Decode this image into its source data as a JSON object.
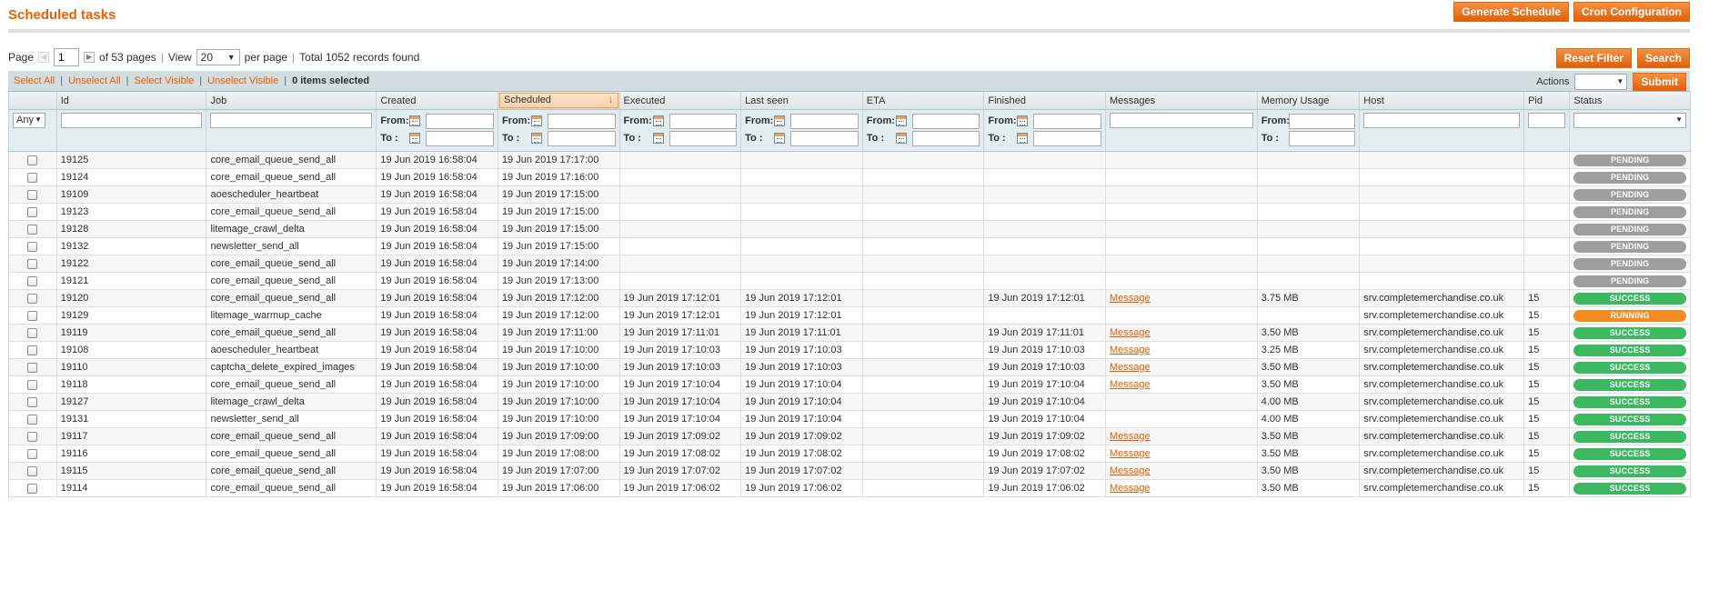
{
  "header": {
    "title": "Scheduled tasks",
    "generate_schedule_label": "Generate Schedule",
    "cron_configuration_label": "Cron Configuration"
  },
  "pager": {
    "page_label": "Page",
    "current_page": "1",
    "of_pages": "of 53 pages",
    "view_label": "View",
    "per_page_value": "20",
    "per_page_label": "per page",
    "total_records": "Total 1052 records found",
    "reset_filter_label": "Reset Filter",
    "search_label": "Search"
  },
  "massaction": {
    "select_all": "Select All",
    "unselect_all": "Unselect All",
    "select_visible": "Select Visible",
    "unselect_visible": "Unselect Visible",
    "items_selected": "0 items selected",
    "actions_label": "Actions",
    "submit_label": "Submit"
  },
  "columns": {
    "id": "Id",
    "job": "Job",
    "created": "Created",
    "scheduled": "Scheduled",
    "executed": "Executed",
    "last_seen": "Last seen",
    "eta": "ETA",
    "finished": "Finished",
    "messages": "Messages",
    "memory_usage": "Memory Usage",
    "host": "Host",
    "pid": "Pid",
    "status": "Status"
  },
  "filters": {
    "any_option": "Any",
    "from_label": "From:",
    "to_label": "To :"
  },
  "sort_icon": "sort-down-arrow-icon",
  "colors": {
    "accent": "#eb5e00",
    "pending": "#9e9e9e",
    "success": "#3cb861",
    "running": "#f58b1f"
  },
  "rows": [
    {
      "id": "19125",
      "job": "core_email_queue_send_all",
      "created": "19 Jun 2019 16:58:04",
      "scheduled": "19 Jun 2019 17:17:00",
      "executed": "",
      "last_seen": "",
      "eta": "",
      "finished": "",
      "message": "",
      "memory": "",
      "host": "",
      "pid": "",
      "status": "PENDING"
    },
    {
      "id": "19124",
      "job": "core_email_queue_send_all",
      "created": "19 Jun 2019 16:58:04",
      "scheduled": "19 Jun 2019 17:16:00",
      "executed": "",
      "last_seen": "",
      "eta": "",
      "finished": "",
      "message": "",
      "memory": "",
      "host": "",
      "pid": "",
      "status": "PENDING"
    },
    {
      "id": "19109",
      "job": "aoescheduler_heartbeat",
      "created": "19 Jun 2019 16:58:04",
      "scheduled": "19 Jun 2019 17:15:00",
      "executed": "",
      "last_seen": "",
      "eta": "",
      "finished": "",
      "message": "",
      "memory": "",
      "host": "",
      "pid": "",
      "status": "PENDING"
    },
    {
      "id": "19123",
      "job": "core_email_queue_send_all",
      "created": "19 Jun 2019 16:58:04",
      "scheduled": "19 Jun 2019 17:15:00",
      "executed": "",
      "last_seen": "",
      "eta": "",
      "finished": "",
      "message": "",
      "memory": "",
      "host": "",
      "pid": "",
      "status": "PENDING"
    },
    {
      "id": "19128",
      "job": "litemage_crawl_delta",
      "created": "19 Jun 2019 16:58:04",
      "scheduled": "19 Jun 2019 17:15:00",
      "executed": "",
      "last_seen": "",
      "eta": "",
      "finished": "",
      "message": "",
      "memory": "",
      "host": "",
      "pid": "",
      "status": "PENDING"
    },
    {
      "id": "19132",
      "job": "newsletter_send_all",
      "created": "19 Jun 2019 16:58:04",
      "scheduled": "19 Jun 2019 17:15:00",
      "executed": "",
      "last_seen": "",
      "eta": "",
      "finished": "",
      "message": "",
      "memory": "",
      "host": "",
      "pid": "",
      "status": "PENDING"
    },
    {
      "id": "19122",
      "job": "core_email_queue_send_all",
      "created": "19 Jun 2019 16:58:04",
      "scheduled": "19 Jun 2019 17:14:00",
      "executed": "",
      "last_seen": "",
      "eta": "",
      "finished": "",
      "message": "",
      "memory": "",
      "host": "",
      "pid": "",
      "status": "PENDING"
    },
    {
      "id": "19121",
      "job": "core_email_queue_send_all",
      "created": "19 Jun 2019 16:58:04",
      "scheduled": "19 Jun 2019 17:13:00",
      "executed": "",
      "last_seen": "",
      "eta": "",
      "finished": "",
      "message": "",
      "memory": "",
      "host": "",
      "pid": "",
      "status": "PENDING"
    },
    {
      "id": "19120",
      "job": "core_email_queue_send_all",
      "created": "19 Jun 2019 16:58:04",
      "scheduled": "19 Jun 2019 17:12:00",
      "executed": "19 Jun 2019 17:12:01",
      "last_seen": "19 Jun 2019 17:12:01",
      "eta": "",
      "finished": "19 Jun 2019 17:12:01",
      "message": "Message",
      "memory": "3.75 MB",
      "host": "srv.completemerchandise.co.uk",
      "pid": "15",
      "status": "SUCCESS"
    },
    {
      "id": "19129",
      "job": "litemage_warmup_cache",
      "created": "19 Jun 2019 16:58:04",
      "scheduled": "19 Jun 2019 17:12:00",
      "executed": "19 Jun 2019 17:12:01",
      "last_seen": "19 Jun 2019 17:12:01",
      "eta": "",
      "finished": "",
      "message": "",
      "memory": "",
      "host": "srv.completemerchandise.co.uk",
      "pid": "15",
      "status": "RUNNING"
    },
    {
      "id": "19119",
      "job": "core_email_queue_send_all",
      "created": "19 Jun 2019 16:58:04",
      "scheduled": "19 Jun 2019 17:11:00",
      "executed": "19 Jun 2019 17:11:01",
      "last_seen": "19 Jun 2019 17:11:01",
      "eta": "",
      "finished": "19 Jun 2019 17:11:01",
      "message": "Message",
      "memory": "3.50 MB",
      "host": "srv.completemerchandise.co.uk",
      "pid": "15",
      "status": "SUCCESS"
    },
    {
      "id": "19108",
      "job": "aoescheduler_heartbeat",
      "created": "19 Jun 2019 16:58:04",
      "scheduled": "19 Jun 2019 17:10:00",
      "executed": "19 Jun 2019 17:10:03",
      "last_seen": "19 Jun 2019 17:10:03",
      "eta": "",
      "finished": "19 Jun 2019 17:10:03",
      "message": "Message",
      "memory": "3.25 MB",
      "host": "srv.completemerchandise.co.uk",
      "pid": "15",
      "status": "SUCCESS"
    },
    {
      "id": "19110",
      "job": "captcha_delete_expired_images",
      "created": "19 Jun 2019 16:58:04",
      "scheduled": "19 Jun 2019 17:10:00",
      "executed": "19 Jun 2019 17:10:03",
      "last_seen": "19 Jun 2019 17:10:03",
      "eta": "",
      "finished": "19 Jun 2019 17:10:03",
      "message": "Message",
      "memory": "3.50 MB",
      "host": "srv.completemerchandise.co.uk",
      "pid": "15",
      "status": "SUCCESS"
    },
    {
      "id": "19118",
      "job": "core_email_queue_send_all",
      "created": "19 Jun 2019 16:58:04",
      "scheduled": "19 Jun 2019 17:10:00",
      "executed": "19 Jun 2019 17:10:04",
      "last_seen": "19 Jun 2019 17:10:04",
      "eta": "",
      "finished": "19 Jun 2019 17:10:04",
      "message": "Message",
      "memory": "3.50 MB",
      "host": "srv.completemerchandise.co.uk",
      "pid": "15",
      "status": "SUCCESS"
    },
    {
      "id": "19127",
      "job": "litemage_crawl_delta",
      "created": "19 Jun 2019 16:58:04",
      "scheduled": "19 Jun 2019 17:10:00",
      "executed": "19 Jun 2019 17:10:04",
      "last_seen": "19 Jun 2019 17:10:04",
      "eta": "",
      "finished": "19 Jun 2019 17:10:04",
      "message": "",
      "memory": "4.00 MB",
      "host": "srv.completemerchandise.co.uk",
      "pid": "15",
      "status": "SUCCESS"
    },
    {
      "id": "19131",
      "job": "newsletter_send_all",
      "created": "19 Jun 2019 16:58:04",
      "scheduled": "19 Jun 2019 17:10:00",
      "executed": "19 Jun 2019 17:10:04",
      "last_seen": "19 Jun 2019 17:10:04",
      "eta": "",
      "finished": "19 Jun 2019 17:10:04",
      "message": "",
      "memory": "4.00 MB",
      "host": "srv.completemerchandise.co.uk",
      "pid": "15",
      "status": "SUCCESS"
    },
    {
      "id": "19117",
      "job": "core_email_queue_send_all",
      "created": "19 Jun 2019 16:58:04",
      "scheduled": "19 Jun 2019 17:09:00",
      "executed": "19 Jun 2019 17:09:02",
      "last_seen": "19 Jun 2019 17:09:02",
      "eta": "",
      "finished": "19 Jun 2019 17:09:02",
      "message": "Message",
      "memory": "3.50 MB",
      "host": "srv.completemerchandise.co.uk",
      "pid": "15",
      "status": "SUCCESS"
    },
    {
      "id": "19116",
      "job": "core_email_queue_send_all",
      "created": "19 Jun 2019 16:58:04",
      "scheduled": "19 Jun 2019 17:08:00",
      "executed": "19 Jun 2019 17:08:02",
      "last_seen": "19 Jun 2019 17:08:02",
      "eta": "",
      "finished": "19 Jun 2019 17:08:02",
      "message": "Message",
      "memory": "3.50 MB",
      "host": "srv.completemerchandise.co.uk",
      "pid": "15",
      "status": "SUCCESS"
    },
    {
      "id": "19115",
      "job": "core_email_queue_send_all",
      "created": "19 Jun 2019 16:58:04",
      "scheduled": "19 Jun 2019 17:07:00",
      "executed": "19 Jun 2019 17:07:02",
      "last_seen": "19 Jun 2019 17:07:02",
      "eta": "",
      "finished": "19 Jun 2019 17:07:02",
      "message": "Message",
      "memory": "3.50 MB",
      "host": "srv.completemerchandise.co.uk",
      "pid": "15",
      "status": "SUCCESS"
    },
    {
      "id": "19114",
      "job": "core_email_queue_send_all",
      "created": "19 Jun 2019 16:58:04",
      "scheduled": "19 Jun 2019 17:06:00",
      "executed": "19 Jun 2019 17:06:02",
      "last_seen": "19 Jun 2019 17:06:02",
      "eta": "",
      "finished": "19 Jun 2019 17:06:02",
      "message": "Message",
      "memory": "3.50 MB",
      "host": "srv.completemerchandise.co.uk",
      "pid": "15",
      "status": "SUCCESS"
    }
  ]
}
